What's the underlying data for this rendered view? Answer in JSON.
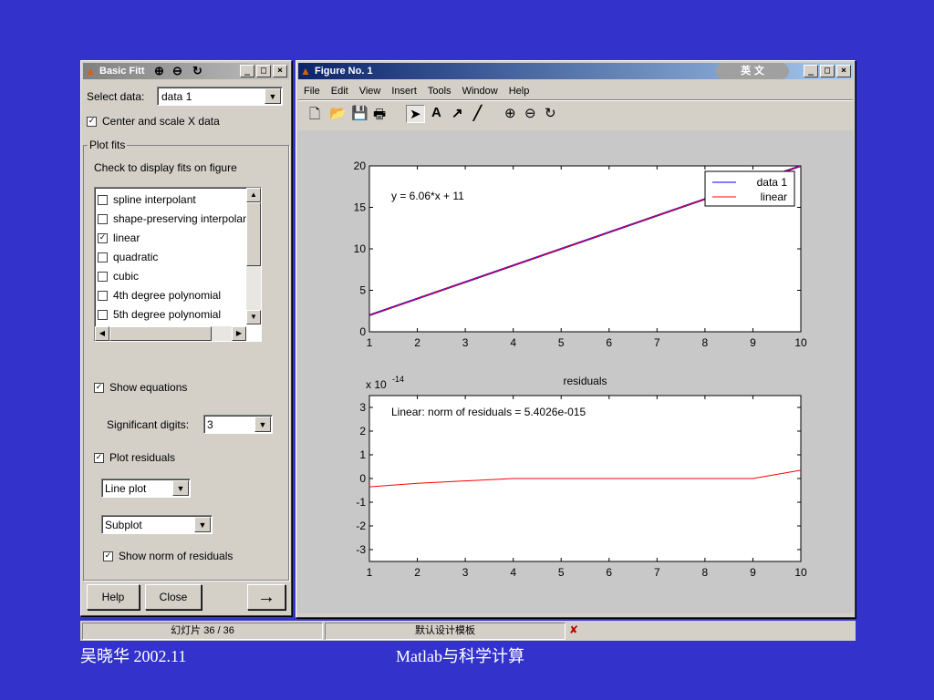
{
  "colors": {
    "desktop": "#3333cc",
    "title_active": "#0a246a",
    "data_line": "#0000ff",
    "fit_line": "#ff0000"
  },
  "basic_fitting": {
    "title": "Basic Fitt",
    "select_data_label": "Select data:",
    "select_data_value": "data 1",
    "center_scale_label": "Center and scale X data",
    "plot_fits_legend": "Plot fits",
    "check_hint": "Check to display fits on figure",
    "fit_options": [
      {
        "label": "spline interpolant",
        "checked": false
      },
      {
        "label": "shape-preserving interpolant",
        "checked": false
      },
      {
        "label": "linear",
        "checked": true
      },
      {
        "label": "quadratic",
        "checked": false
      },
      {
        "label": "cubic",
        "checked": false
      },
      {
        "label": "4th degree polynomial",
        "checked": false
      },
      {
        "label": "5th degree polynomial",
        "checked": false
      }
    ],
    "show_equations_label": "Show equations",
    "sig_digits_label": "Significant digits:",
    "sig_digits_value": "3",
    "plot_residuals_label": "Plot residuals",
    "residual_plot_type": "Line plot",
    "residual_layout": "Subplot",
    "show_norm_label": "Show norm of residuals",
    "help_label": "Help",
    "close_label": "Close",
    "arrow_label": "→"
  },
  "figure": {
    "title": "Figure No. 1",
    "menus": [
      "File",
      "Edit",
      "View",
      "Insert",
      "Tools",
      "Window",
      "Help"
    ],
    "ime_label": "英 文"
  },
  "chart_data": [
    {
      "type": "line",
      "title": "",
      "xlim": [
        1,
        10
      ],
      "ylim": [
        0,
        20
      ],
      "xticks": [
        "1",
        "2",
        "3",
        "4",
        "5",
        "6",
        "7",
        "8",
        "9",
        "10"
      ],
      "yticks": [
        "0",
        "5",
        "10",
        "15",
        "20"
      ],
      "annotation": "y = 6.06*x + 11",
      "legend": [
        "data 1",
        "linear"
      ],
      "legend_placement": "top-right",
      "series": [
        {
          "name": "data 1",
          "color": "#0000ff",
          "x": [
            1,
            10
          ],
          "y": [
            2,
            20
          ]
        },
        {
          "name": "linear",
          "color": "#ff0000",
          "x": [
            1,
            10
          ],
          "y": [
            2,
            20
          ]
        }
      ]
    },
    {
      "type": "line",
      "title": "residuals",
      "exponent_label": "x 10",
      "exponent_power": "-14",
      "xlim": [
        1,
        10
      ],
      "ylim": [
        -3.5,
        3.5
      ],
      "xticks": [
        "1",
        "2",
        "3",
        "4",
        "5",
        "6",
        "7",
        "8",
        "9",
        "10"
      ],
      "yticks": [
        "3",
        "2",
        "1",
        "0",
        "-1",
        "-2",
        "-3"
      ],
      "annotation": "Linear: norm of residuals = 5.4026e-015",
      "series": [
        {
          "name": "linear",
          "color": "#ff0000",
          "x": [
            1,
            2,
            3,
            4,
            5,
            6,
            7,
            8,
            9,
            10
          ],
          "y": [
            -0.35,
            -0.2,
            -0.1,
            0,
            0,
            0,
            0,
            0,
            0,
            0.35
          ]
        }
      ]
    }
  ],
  "statusbar": {
    "slide": "幻灯片 36 / 36",
    "template": "默认设计模板"
  },
  "footer": {
    "author_date": "吴晓华   2002.11",
    "course": "Matlab与科学计算"
  }
}
